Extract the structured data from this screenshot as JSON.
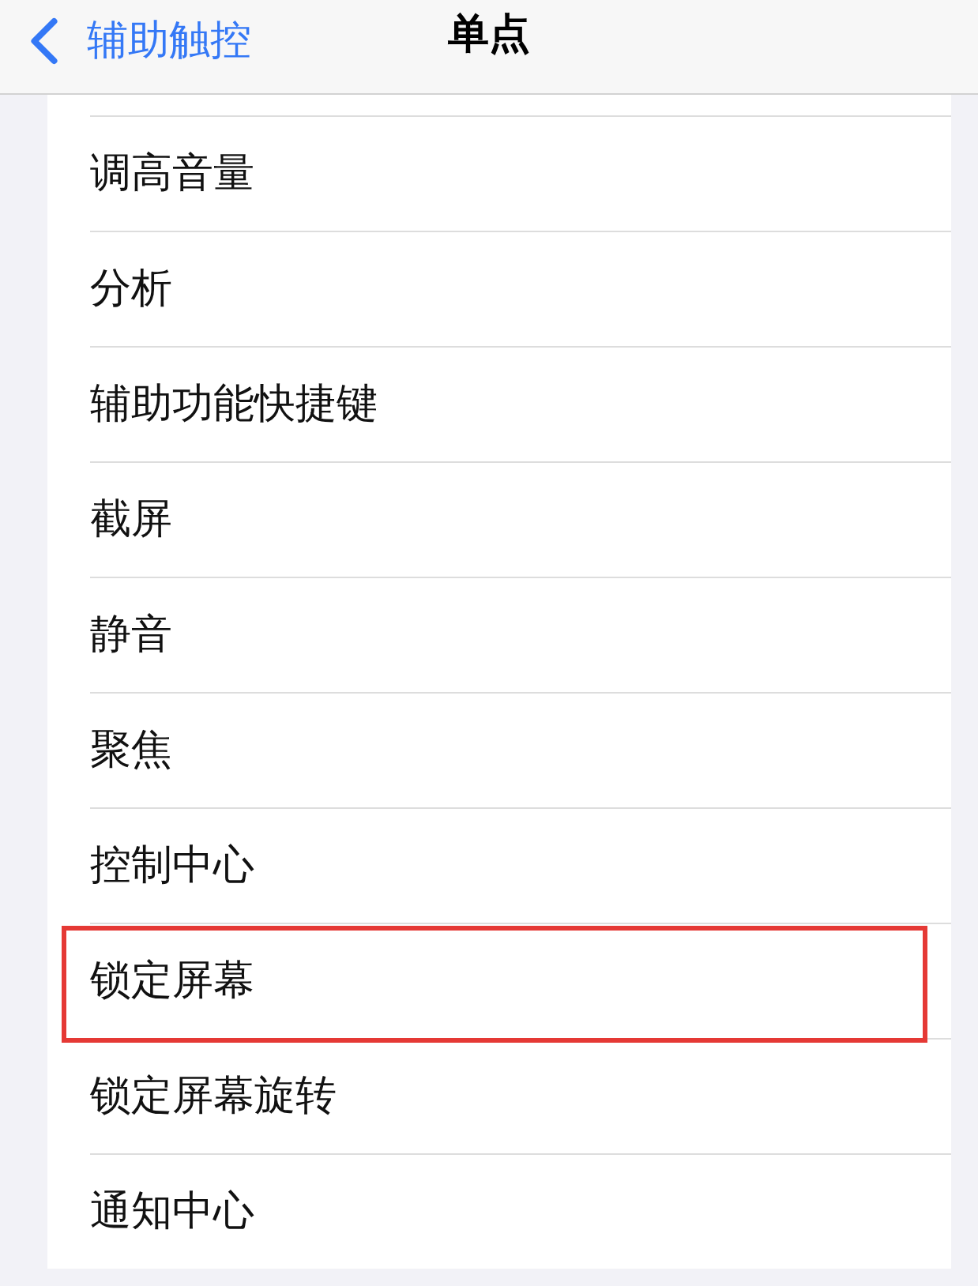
{
  "nav_bar": {
    "back_label": "辅助触控",
    "title": "单点"
  },
  "items": [
    {
      "label": "调高音量",
      "highlighted": false
    },
    {
      "label": "分析",
      "highlighted": false
    },
    {
      "label": "辅助功能快捷键",
      "highlighted": false
    },
    {
      "label": "截屏",
      "highlighted": false
    },
    {
      "label": "静音",
      "highlighted": false
    },
    {
      "label": "聚焦",
      "highlighted": false
    },
    {
      "label": "控制中心",
      "highlighted": false
    },
    {
      "label": "锁定屏幕",
      "highlighted": true
    },
    {
      "label": "锁定屏幕旋转",
      "highlighted": false
    },
    {
      "label": "通知中心",
      "highlighted": false
    }
  ]
}
